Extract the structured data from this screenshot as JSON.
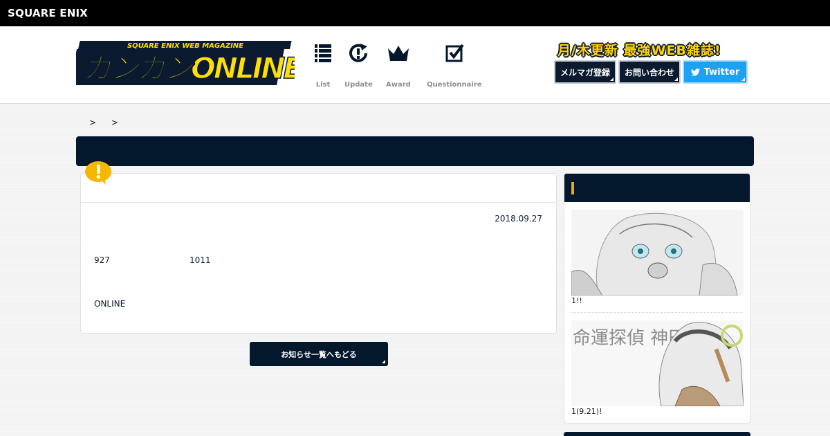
{
  "topbar": {
    "brand": "SQUARE ENIX"
  },
  "header": {
    "logo_text": "ガンガンONLINE",
    "logo_sub": "SQUARE ENIX WEB MAGAZINE",
    "nav": [
      {
        "label": "List",
        "icon": "list-icon"
      },
      {
        "label": "Update",
        "icon": "update-icon"
      },
      {
        "label": "Award",
        "icon": "crown-icon"
      },
      {
        "label": "Questionnaire",
        "icon": "checkbox-icon"
      }
    ],
    "tagline": "月/木更新 最強WEB雑誌!",
    "buttons": {
      "mailmag": "メルマガ登録",
      "contact": "お問い合わせ",
      "twitter": "Twitter"
    }
  },
  "breadcrumb": {
    "sep1": ">",
    "sep2": ">"
  },
  "article": {
    "date": "2018.09.27",
    "line1_a": "927",
    "line1_b": "1011",
    "line2": "ONLINE"
  },
  "back_button": "お知らせ一覧へもどる",
  "sidebar": {
    "items": [
      {
        "caption": "1!!"
      },
      {
        "caption": "1(9.21)!"
      }
    ],
    "thumb2_title": "命運探偵 神田川"
  },
  "colors": {
    "navy": "#03172d",
    "accent": "#f5a800",
    "twitter": "#1da1f2",
    "logo_yellow": "#ffe000"
  }
}
